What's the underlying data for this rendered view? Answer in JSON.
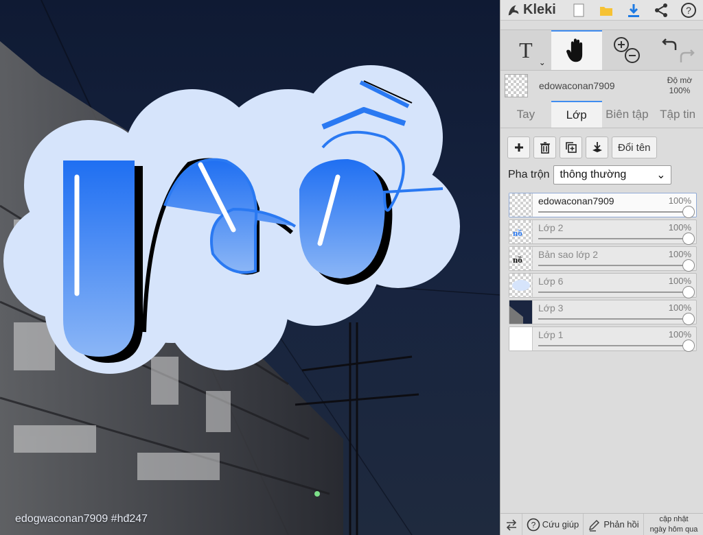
{
  "canvas": {
    "watermark": "edogwaconan7909   #hđ247"
  },
  "app": {
    "name": "Kleki"
  },
  "toolbar": {
    "top_icons": [
      "new-file-icon",
      "open-folder-icon",
      "download-icon",
      "share-icon",
      "help-icon"
    ],
    "tools": [
      {
        "id": "text",
        "icon": "text-tool-icon",
        "label": "T"
      },
      {
        "id": "hand",
        "icon": "hand-tool-icon",
        "active": true
      },
      {
        "id": "zoom",
        "icon": "zoom-icon"
      },
      {
        "id": "undo",
        "icon": "undo-redo-icon"
      }
    ]
  },
  "current_layer": {
    "name": "edowaconan7909",
    "opacity_label": "Độ mờ",
    "opacity_value": "100%"
  },
  "tabs": [
    {
      "label": "Tay"
    },
    {
      "label": "Lớp",
      "active": true
    },
    {
      "label": "Biên tập"
    },
    {
      "label": "Tập tin"
    }
  ],
  "layer_actions": {
    "rename_label": "Đổi tên"
  },
  "blend": {
    "label": "Pha trộn",
    "value": "thông thường"
  },
  "layers": [
    {
      "name": "edowaconan7909",
      "opacity": "100%",
      "selected": true
    },
    {
      "name": "Lớp 2",
      "opacity": "100%"
    },
    {
      "name": "Bản sao lớp 2",
      "opacity": "100%"
    },
    {
      "name": "Lớp 6",
      "opacity": "100%"
    },
    {
      "name": "Lớp 3",
      "opacity": "100%"
    },
    {
      "name": "Lớp 1",
      "opacity": "100%"
    }
  ],
  "bottombar": {
    "help_label": "Cứu giúp",
    "feedback_label": "Phản hồi",
    "update_line1": "cập nhật",
    "update_line2": "ngày hôm qua"
  },
  "colors": {
    "accent": "#3f8cf0",
    "sticker_bg": "#d6e4fb",
    "letter_blue": "#2a79f2"
  }
}
